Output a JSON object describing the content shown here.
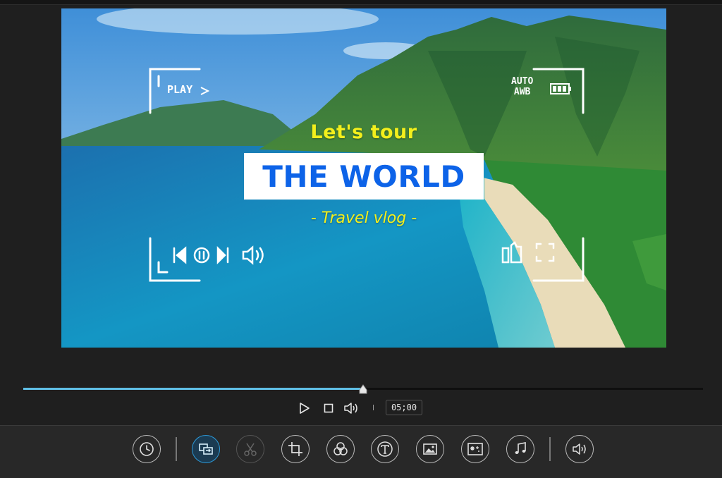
{
  "preview": {
    "headline_top": "Let's tour",
    "headline_main": "THE WORLD",
    "headline_sub": "- Travel vlog -",
    "cam_play_label": "PLAY",
    "cam_auto_label": "AUTO",
    "cam_awb_label": "AWB"
  },
  "playback": {
    "progress": 0.5,
    "time": "05;00"
  },
  "toolbar": {
    "tools": [
      {
        "name": "speed-tool-button",
        "icon": "clock-icon",
        "state": "normal"
      },
      {
        "name": "transition-tool-button",
        "icon": "transition-icon",
        "state": "active"
      },
      {
        "name": "cut-tool-button",
        "icon": "scissors-icon",
        "state": "disabled"
      },
      {
        "name": "crop-tool-button",
        "icon": "crop-icon",
        "state": "normal"
      },
      {
        "name": "filter-tool-button",
        "icon": "filter-circles-icon",
        "state": "normal"
      },
      {
        "name": "text-tool-button",
        "icon": "text-icon",
        "state": "normal"
      },
      {
        "name": "image-tool-button",
        "icon": "image-icon",
        "state": "normal"
      },
      {
        "name": "effects-tool-button",
        "icon": "sparkle-effects-icon",
        "state": "normal"
      },
      {
        "name": "music-tool-button",
        "icon": "music-note-icon",
        "state": "normal"
      },
      {
        "name": "volume-tool-button",
        "icon": "speaker-icon",
        "state": "normal"
      }
    ]
  },
  "colors": {
    "accent": "#5fbfe6",
    "active_tool": "#2d9ad8",
    "headline_yellow": "#f3ef1c",
    "headline_blue": "#0d63e8"
  }
}
